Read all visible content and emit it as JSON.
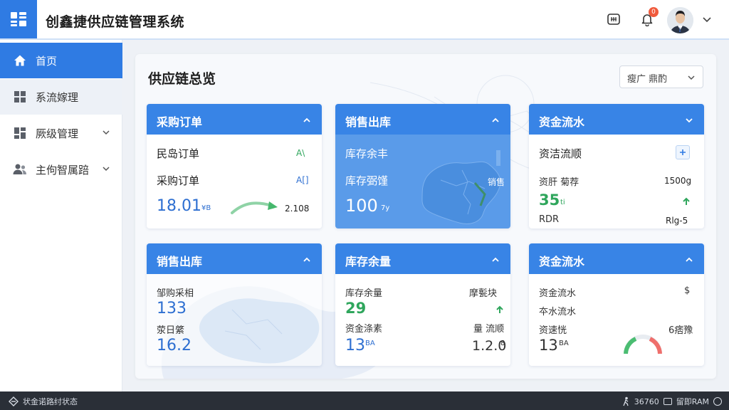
{
  "header": {
    "app_title": "创鑫捷供应链管理系统",
    "notification_count": "0"
  },
  "sidebar": {
    "items": [
      {
        "label": "首页"
      },
      {
        "label": "系流嫁理"
      },
      {
        "label": "厥级管理"
      },
      {
        "label": "主佝智属踣"
      }
    ]
  },
  "main": {
    "page_title": "供应链总览",
    "filter": {
      "selected": "瘦广  鼎酌"
    }
  },
  "cards": {
    "c1": {
      "title": "采购订单",
      "row1_label": "民岛订单",
      "row1_tag": "A\\",
      "row2_label": "采购订单",
      "row2_tag": "A[]",
      "value": "18.01",
      "value_unit": "¥B",
      "side_value": "2.108"
    },
    "c2": {
      "title": "销售出库",
      "row1_label": "库存余丰",
      "row2_label": "库存弼馑",
      "row2_right": "销售",
      "value": "100",
      "value_unit": "7y"
    },
    "c3": {
      "title": "资金流水",
      "row1_label": "资洁流顺",
      "row2_label": "资肝 菊荐",
      "row2_right": "1500g",
      "value": "35",
      "value_unit": "ti",
      "row4_label": "RDR",
      "row4_right": "Rlg-5"
    },
    "c4": {
      "title": "销售出库",
      "row1_label": "邹购采相",
      "value1": "133",
      "row2_label": "荥日綮",
      "value2": "16.2"
    },
    "c5": {
      "title": "库存余量",
      "row1_label": "库存余量",
      "row1_right": "摩甏块",
      "value1": "29",
      "row2_label": "资金涤素",
      "row2_right": "量 流顺",
      "value2": "13",
      "value2_unit": "BA",
      "side_value": "1.2.0",
      "side_unit": "8"
    },
    "c6": {
      "title": "资金流水",
      "row1_label": "资金流水",
      "row1_right": "$",
      "row2_label": "夲水流水",
      "row3_label": "资速恍",
      "row3_right": "6痞豫",
      "value": "13",
      "value_unit": "BA"
    }
  },
  "statusbar": {
    "left_text": "状金诺路纣状态",
    "right_value": "36760",
    "right_text": "留即RAM"
  },
  "colors": {
    "primary": "#2f7be3",
    "card_header": "#3884e6",
    "value_blue": "#2e6fd1",
    "value_green": "#2fa65c",
    "badge_red": "#f05a3c",
    "statusbar_bg": "#2a2f37"
  }
}
